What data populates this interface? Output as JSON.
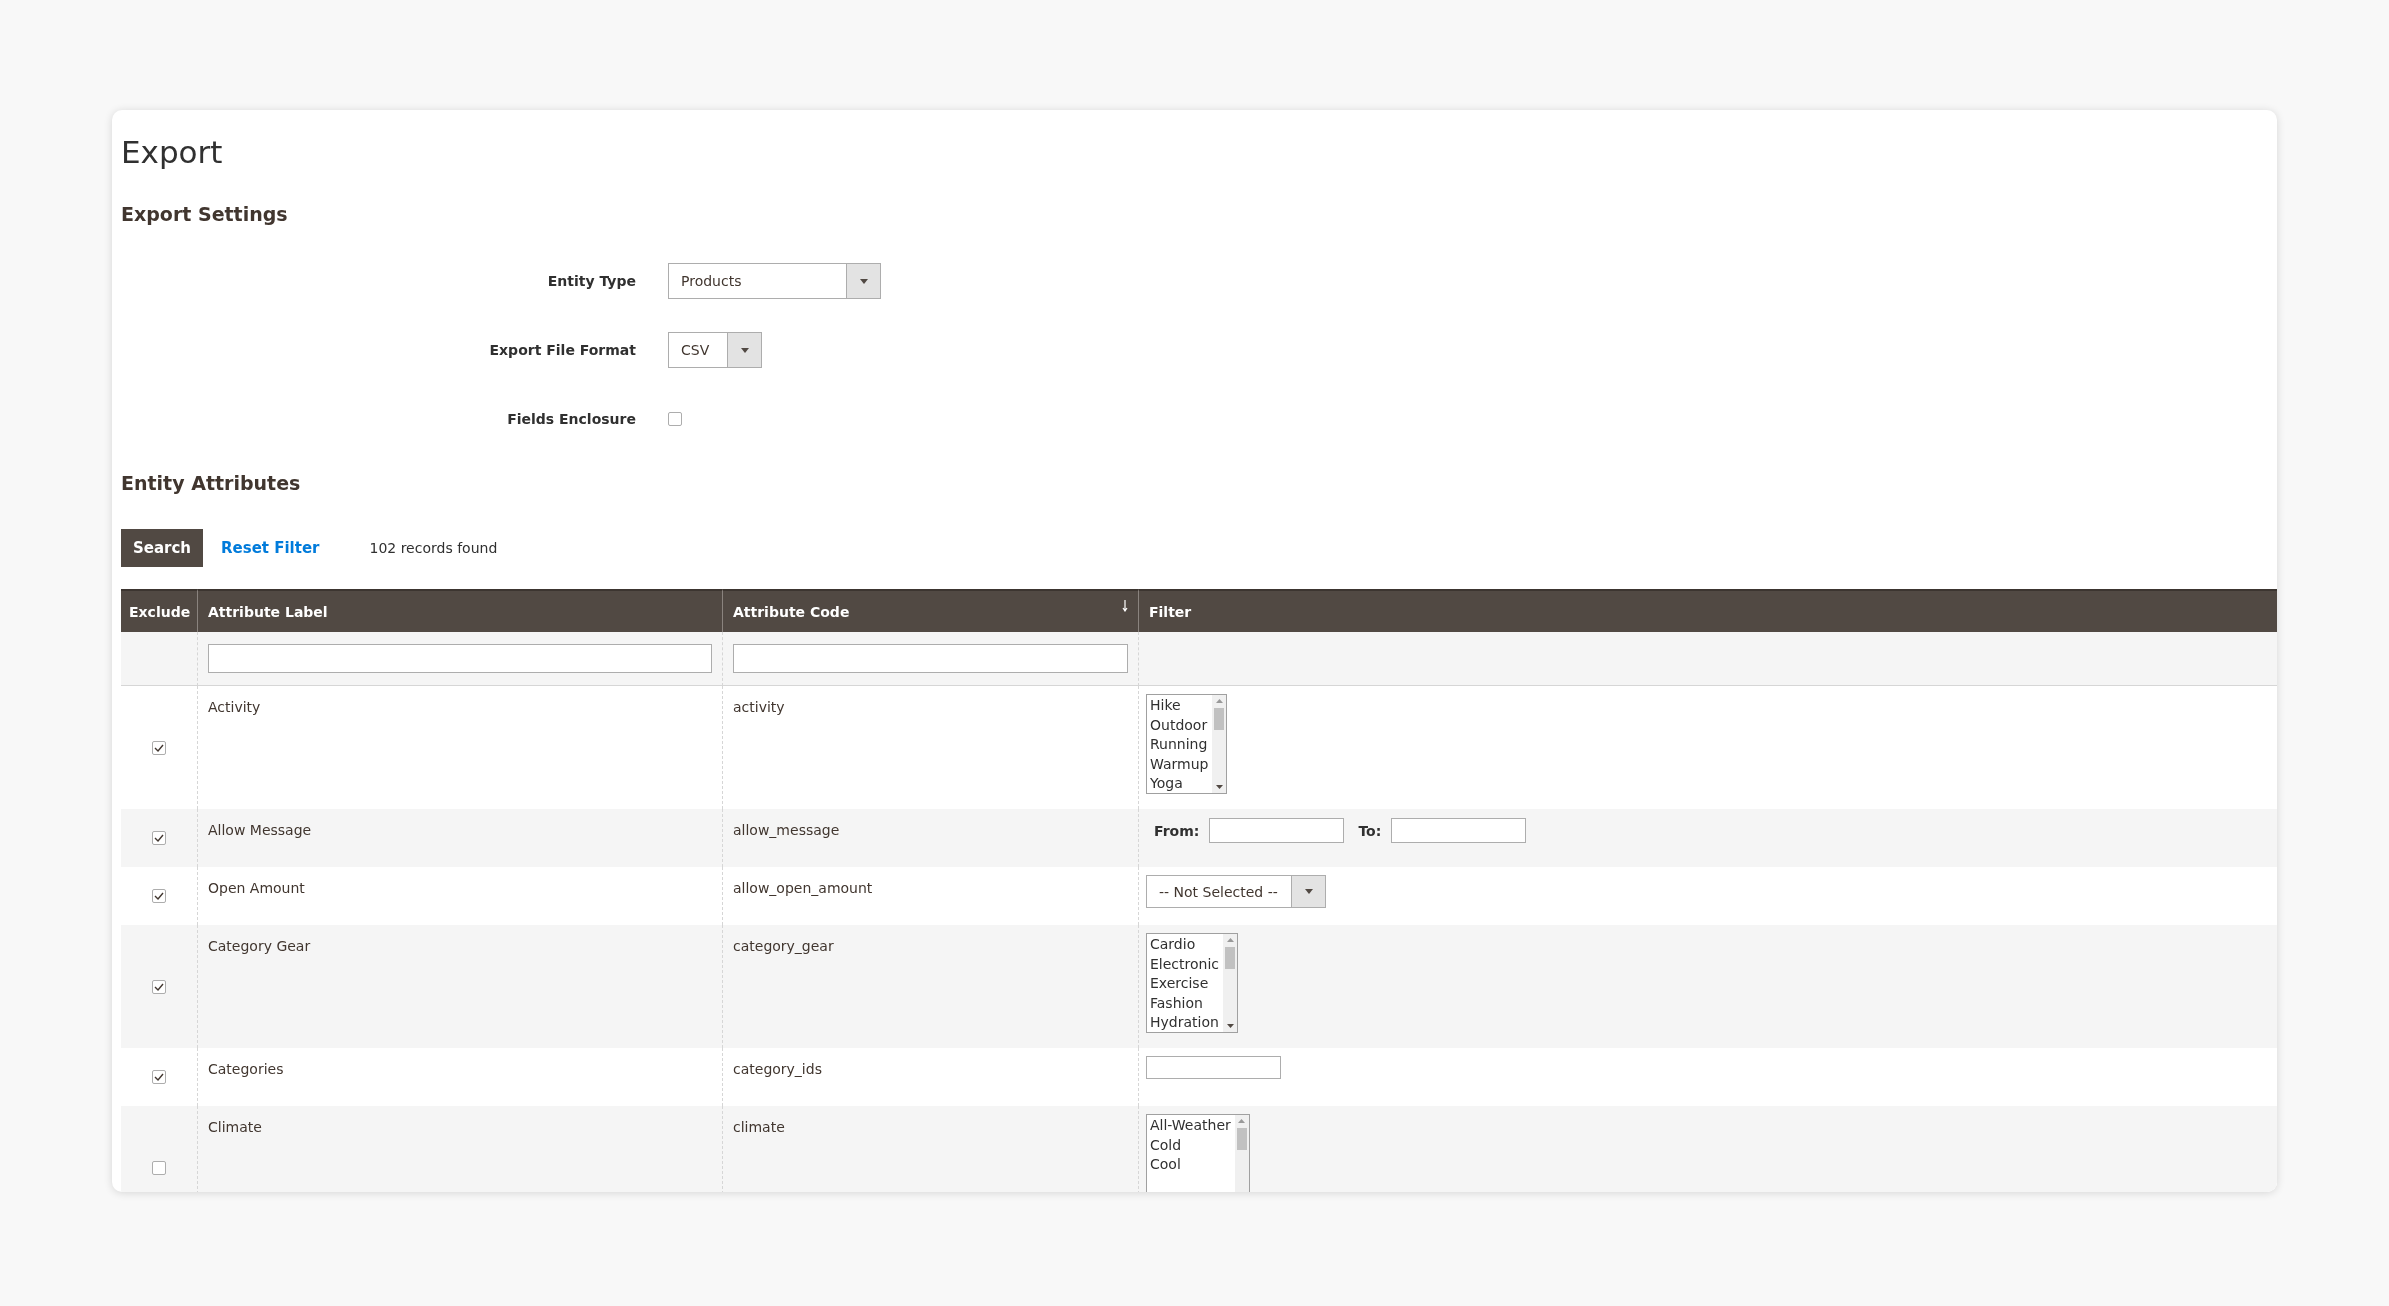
{
  "page_title": "Export",
  "export_settings": {
    "heading": "Export Settings",
    "fields": [
      {
        "kind": "select",
        "label": "Entity Type",
        "value": "Products"
      },
      {
        "kind": "select",
        "label": "Export File Format",
        "value": "CSV"
      },
      {
        "kind": "checkbox",
        "label": "Fields Enclosure",
        "checked": false
      }
    ]
  },
  "entity_attributes": {
    "heading": "Entity Attributes",
    "search_button": "Search",
    "reset_link": "Reset Filter",
    "records": "102 records found",
    "table": {
      "columns": [
        "Exclude",
        "Attribute Label",
        "Attribute Code",
        "Filter"
      ],
      "rows": [
        {
          "exclude": true,
          "label": "Activity",
          "code": "activity",
          "filter": {
            "kind": "listbox",
            "options": [
              "Hike",
              "Outdoor",
              "Running",
              "Warmup",
              "Yoga"
            ]
          }
        },
        {
          "exclude": true,
          "label": "Allow Message",
          "code": "allow_message",
          "filter": {
            "kind": "range",
            "from_label": "From:",
            "to_label": "To:"
          }
        },
        {
          "exclude": true,
          "label": "Open Amount",
          "code": "allow_open_amount",
          "filter": {
            "kind": "select",
            "value": "-- Not Selected --"
          }
        },
        {
          "exclude": true,
          "label": "Category Gear",
          "code": "category_gear",
          "filter": {
            "kind": "listbox",
            "options": [
              "Cardio",
              "Electronic",
              "Exercise",
              "Fashion",
              "Hydration"
            ]
          }
        },
        {
          "exclude": true,
          "label": "Categories",
          "code": "category_ids",
          "filter": {
            "kind": "text"
          }
        },
        {
          "exclude": false,
          "label": "Climate",
          "code": "climate",
          "filter": {
            "kind": "listbox",
            "options": [
              "All-Weather",
              "Cold",
              "Cool"
            ]
          }
        }
      ]
    }
  }
}
